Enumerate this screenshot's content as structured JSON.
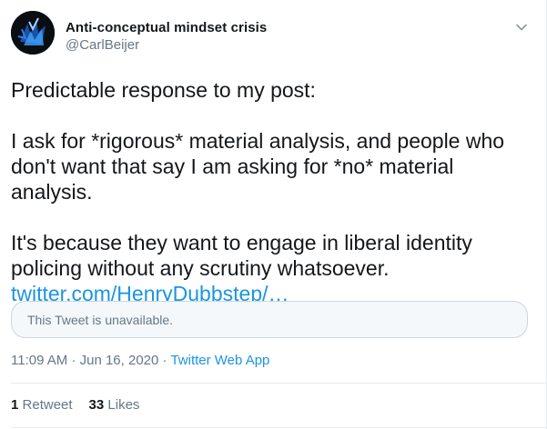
{
  "author": {
    "display_name": "Anti-conceptual mindset crisis",
    "handle": "@CarlBeijer"
  },
  "tweet": {
    "line1": "Predictable response to my post:",
    "paragraph2": "I ask for *rigorous* material analysis, and people who don't want that say I am asking for *no* material analysis.",
    "paragraph3": "It's because they want to engage in liberal identity policing without any scrutiny whatsoever.",
    "link": "twitter.com/HenryDubbstep/…"
  },
  "quoted": {
    "unavailable_text": "This Tweet is unavailable."
  },
  "meta": {
    "time": "11:09 AM",
    "date": "Jun 16, 2020",
    "separator": "·",
    "source": "Twitter Web App"
  },
  "stats": {
    "retweets_count": "1",
    "retweets_label": "Retweet",
    "likes_count": "33",
    "likes_label": "Likes"
  },
  "colors": {
    "link": "#1b95e0",
    "secondary_text": "#657786",
    "border": "#e6ecf0"
  },
  "icons": {
    "avatar": "blue-abstract-figure-avatar",
    "menu": "chevron-down-icon"
  }
}
